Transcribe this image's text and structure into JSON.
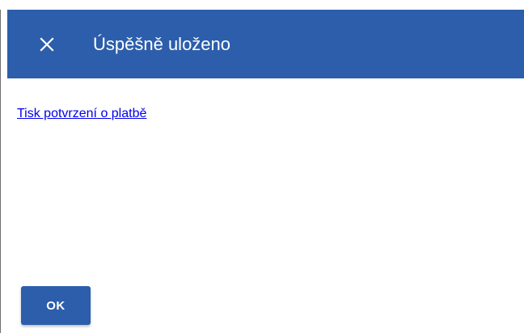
{
  "dialog": {
    "title": "Úspěšně uloženo",
    "close_icon": "close-icon",
    "link_text": "Tisk potvrzení o platbě",
    "ok_label": "OK"
  },
  "colors": {
    "header_bg": "#2c5eab",
    "header_text": "#ffffff",
    "link": "#0000ee",
    "button_bg": "#2c5eab"
  }
}
